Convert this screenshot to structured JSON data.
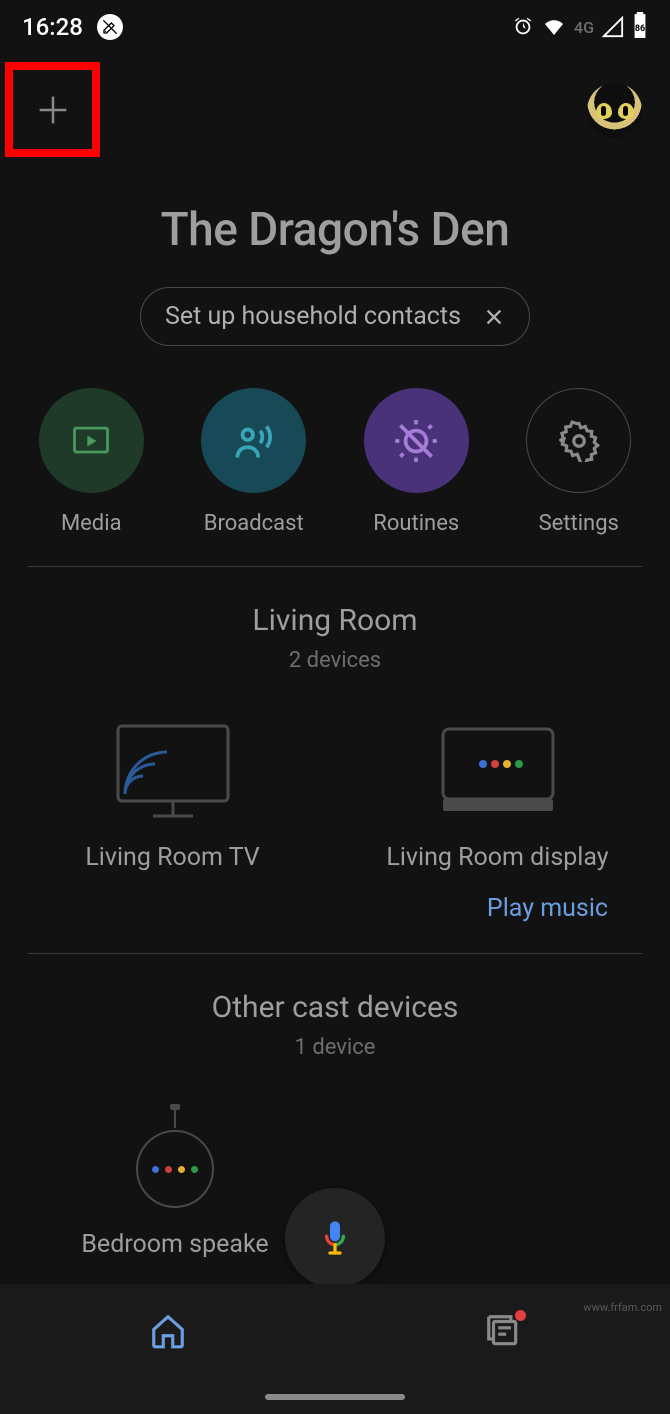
{
  "status": {
    "time": "16:28",
    "network": "4G",
    "battery": "86"
  },
  "home": {
    "title": "The Dragon's Den"
  },
  "pill": {
    "label": "Set up household contacts"
  },
  "quick": {
    "media": "Media",
    "broadcast": "Broadcast",
    "routines": "Routines",
    "settings": "Settings"
  },
  "rooms": {
    "living": {
      "title": "Living Room",
      "sub": "2 devices",
      "tv": "Living Room TV",
      "display": "Living Room display",
      "play": "Play music"
    },
    "other": {
      "title": "Other cast devices",
      "sub": "1 device",
      "speaker": "Bedroom speake"
    }
  },
  "watermark": "www.frfam.com"
}
